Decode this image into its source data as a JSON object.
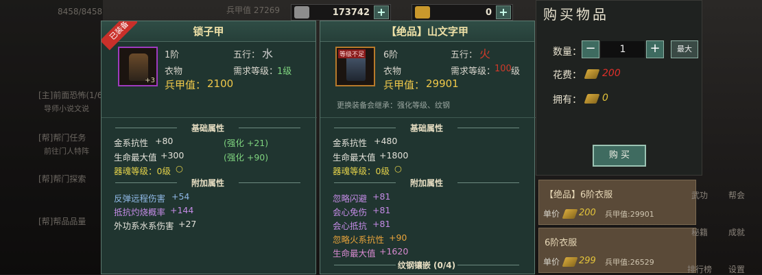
{
  "topbar": {
    "resource1": "173742",
    "resource2": "0",
    "faded_left": "8458/8458",
    "faded_mid": "兵甲值 27269"
  },
  "left_faded": {
    "q1": "[主]前面恐怖(1/6)",
    "q2": "导师小说文说",
    "q3": "[帮]帮门任务",
    "q4": "前往门人特阵",
    "q5": "[帮]帮门探索",
    "q6": "[帮]帮品品量"
  },
  "equipped": {
    "ribbon": "已装备",
    "title": "锁子甲",
    "tier": "1阶",
    "wuxing_label": "五行：",
    "wuxing": "水",
    "type": "衣物",
    "req_label": "需求等级：",
    "req_value": "1级",
    "armor_label": "兵甲值：",
    "armor_value": "2100",
    "badge": "+3",
    "base_title": "基础属性",
    "base_stats": [
      {
        "name": "金系抗性",
        "value": "+80",
        "bonus": "(强化 +21)"
      },
      {
        "name": "生命最大值",
        "value": "+300",
        "bonus": "(强化 +90)"
      }
    ],
    "soul": "器魂等级：0级",
    "extra_title": "附加属性",
    "extra_stats": [
      {
        "name": "反弹远程伤害",
        "value": "+54"
      },
      {
        "name": "抵抗灼烧概率",
        "value": "+144"
      },
      {
        "name": "外功系水系伤害",
        "value": "+27"
      }
    ]
  },
  "item": {
    "title": "【绝品】山文字甲",
    "tag": "等级不足",
    "tier": "6阶",
    "wuxing_label": "五行：",
    "wuxing": "火",
    "type": "衣物",
    "req_label": "需求等级：",
    "req_value": "100",
    "req_unit": "级",
    "armor_label": "兵甲值：",
    "armor_value": "29901",
    "hint": "更换装备会继承：强化等级、纹钢",
    "base_title": "基础属性",
    "base_stats": [
      {
        "name": "金系抗性",
        "value": "+480"
      },
      {
        "name": "生命最大值",
        "value": "+1800"
      }
    ],
    "soul": "器魂等级：0级",
    "extra_title": "附加属性",
    "extra_stats": [
      {
        "name": "忽略闪避",
        "value": "+81"
      },
      {
        "name": "会心免伤",
        "value": "+81"
      },
      {
        "name": "会心抵抗",
        "value": "+81"
      },
      {
        "name": "忽略火系抗性",
        "value": "+90"
      },
      {
        "name": "生命最大值",
        "value": "+1620"
      }
    ],
    "inlay": "纹钢镶嵌 (0/4)"
  },
  "buy": {
    "title": "购买物品",
    "qty_label": "数量：",
    "minus": "−",
    "qty": "1",
    "plus": "+",
    "max": "最大",
    "cost_label": "花费：",
    "cost": "200",
    "own_label": "拥有：",
    "own": "0",
    "buy_btn": "购 买"
  },
  "shop_list": [
    {
      "name": "【绝品】6阶衣服",
      "price_label": "单价",
      "price": "200",
      "armor": "兵甲值:29901"
    },
    {
      "name": "6阶衣服",
      "price_label": "单价",
      "price": "299",
      "armor": "兵甲值:26529"
    }
  ],
  "right_labels": {
    "a": "武功",
    "b": "帮会",
    "c": "秘籍",
    "d": "成就",
    "e": "排行榜",
    "f": "设置"
  }
}
